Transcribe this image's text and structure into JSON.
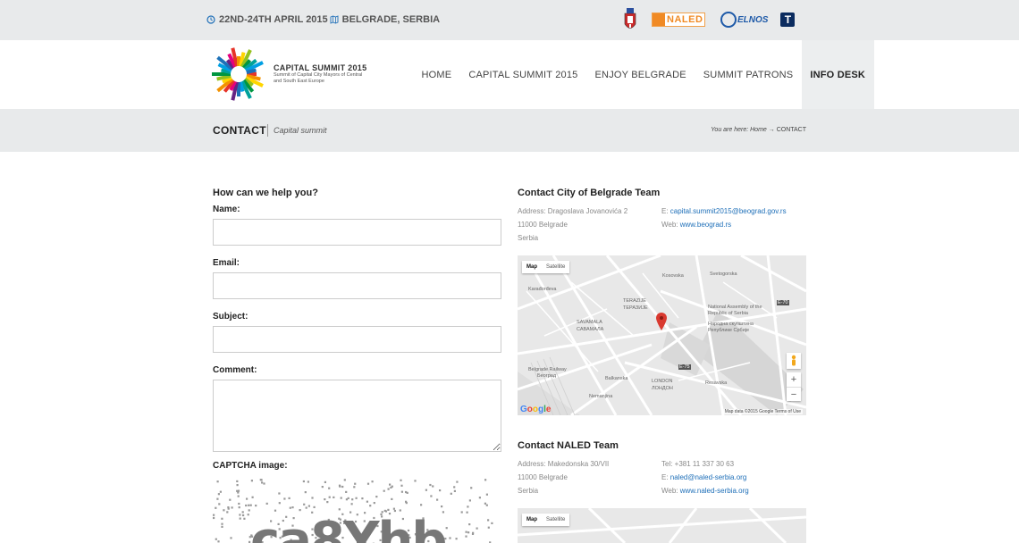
{
  "topbar": {
    "date": "22ND-24TH APRIL 2015",
    "location": "BELGRADE, SERBIA",
    "partners": {
      "naled": "NALED",
      "elnos": "ELNOS",
      "telekom": "T"
    }
  },
  "header": {
    "logo_title": "CAPITAL SUMMIT 2015",
    "logo_sub": "Summit of Capital City Mayors of Central and South East Europe",
    "nav": [
      "HOME",
      "CAPITAL SUMMIT 2015",
      "ENJOY BELGRADE",
      "SUMMIT PATRONS",
      "INFO DESK"
    ]
  },
  "titlebar": {
    "title": "CONTACT",
    "subtitle": "Capital summit",
    "breadcrumb_prefix": "You are here: Home →",
    "breadcrumb_current": "CONTACT"
  },
  "form": {
    "heading": "How can we help you?",
    "name_label": "Name:",
    "email_label": "Email:",
    "subject_label": "Subject:",
    "comment_label": "Comment:",
    "captcha_label": "CAPTCHA image:",
    "captcha_text": "ca8Yhb"
  },
  "contact_city": {
    "heading": "Contact City of Belgrade Team",
    "address1": "Address: Dragoslava Jovanovića 2",
    "address2": "11000 Belgrade",
    "address3": "Serbia",
    "email_prefix": "E: ",
    "email": "capital.summit2015@beograd.gov.rs",
    "web_prefix": "Web: ",
    "web": "www.beograd.rs"
  },
  "contact_naled": {
    "heading": "Contact NALED Team",
    "address1": "Address: Makedonska 30/VII",
    "address2": "11000 Belgrade",
    "address3": "Serbia",
    "tel": "Tel: +381 11 337 30 63",
    "email_prefix": "E: ",
    "email": "naled@naled-serbia.org",
    "web_prefix": "Web: ",
    "web": "www.naled-serbia.org"
  },
  "map": {
    "tab_map": "Map",
    "tab_satellite": "Satellite",
    "zoom_in": "+",
    "zoom_out": "−",
    "footer": "Map data ©2015 Google   Terms of Use",
    "labels": [
      "Svetogorska",
      "Kosovska",
      "TERAZIJE",
      "ТЕРАЗИЈЕ",
      "SAVAMALA",
      "САВАМАЛА",
      "National Assembly of the Republic of Serbia",
      "Народна скупштина Републике Србије",
      "Belgrade Railway",
      "Београд",
      "LONDON",
      "ЛОНДОН",
      "E-70",
      "E-75",
      "Resavska",
      "Nemanjina",
      "Balkanska",
      "Karađorđeva"
    ],
    "google": "Google"
  },
  "colors": {
    "link": "#1e6fb8",
    "bar_bg": "#e8eaeb",
    "pin": "#d93a30"
  }
}
